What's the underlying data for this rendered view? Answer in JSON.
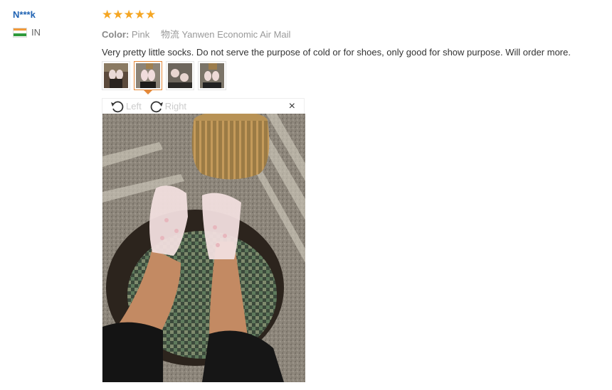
{
  "reviewer": {
    "name": "N***k",
    "country_code": "IN"
  },
  "review": {
    "stars": "★★★★★",
    "color_label": "Color:",
    "color_value": "Pink",
    "shipping_label": "物流",
    "shipping_value": "Yanwen Economic Air Mail",
    "text": "Very pretty little socks. Do not serve the purpose of cold or for shoes, only good for show purpose. Will order more."
  },
  "viewer": {
    "rotate_left_label": "Left",
    "rotate_right_label": "Right",
    "close_label": "×"
  },
  "colors": {
    "accent": "#e4893a",
    "link": "#2063b3",
    "star": "#f5a623"
  }
}
